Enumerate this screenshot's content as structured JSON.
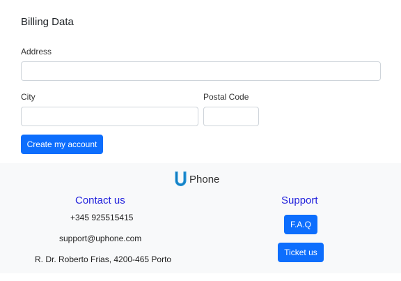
{
  "billing": {
    "title": "Billing Data",
    "address_label": "Address",
    "address_value": "",
    "city_label": "City",
    "city_value": "",
    "postal_label": "Postal Code",
    "postal_value": "",
    "submit_label": "Create my account"
  },
  "footer": {
    "brand_mark": "U",
    "brand_name": "Phone",
    "contact": {
      "title": "Contact us",
      "phone": "+345 925515415",
      "email": "support@uphone.com",
      "address": "R. Dr. Roberto Frias, 4200-465 Porto"
    },
    "support": {
      "title": "Support",
      "faq_label": "F.A.Q",
      "ticket_label": "Ticket us"
    }
  },
  "colors": {
    "primary": "#0d6efd",
    "footer_bg": "#f8f9fa",
    "heading_blue": "#1f1fdc",
    "logo_blue": "#1e90d6"
  }
}
